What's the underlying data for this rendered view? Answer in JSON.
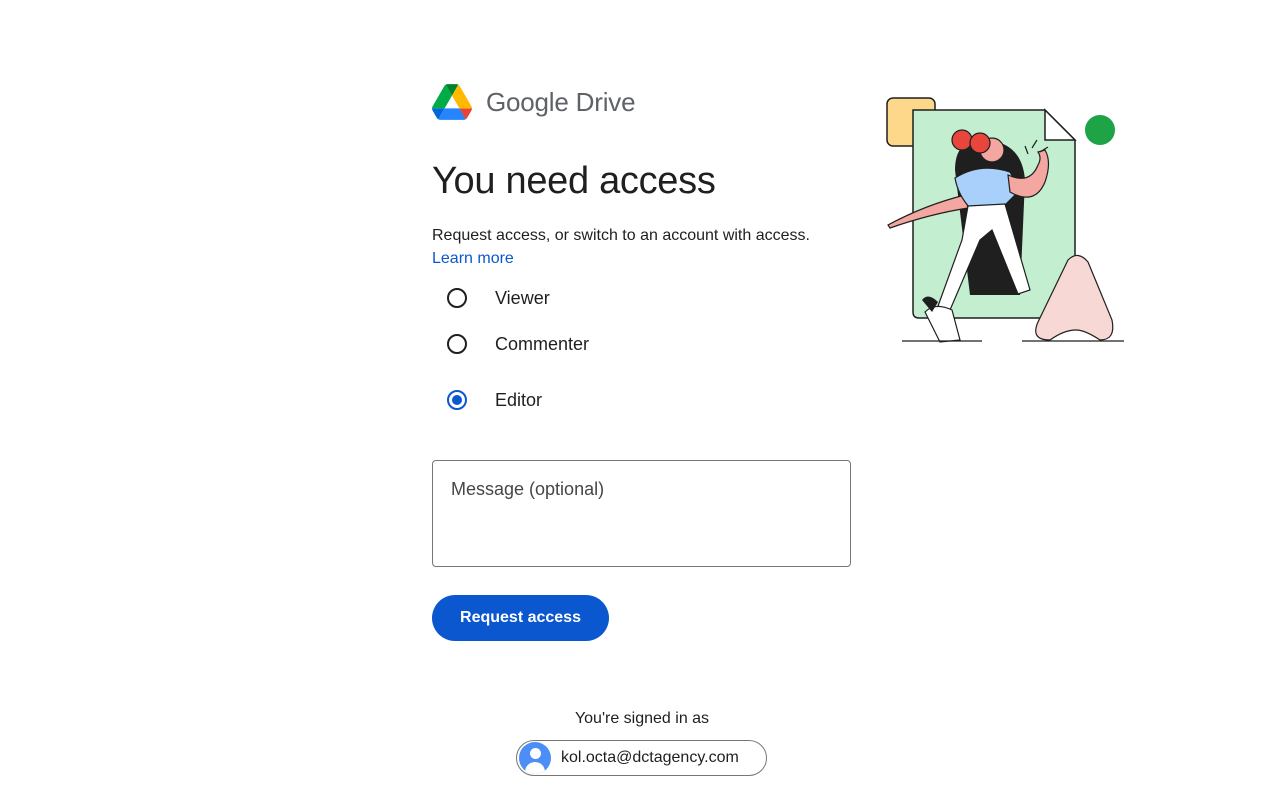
{
  "brand": {
    "name": "Google Drive",
    "logo_colors": {
      "green": "#0f9d58",
      "yellow": "#fbbc04",
      "blue": "#4285f4",
      "red": "#ea4335",
      "dark_green": "#188038"
    }
  },
  "main": {
    "title": "You need access",
    "description": "Request access, or switch to an account with access.",
    "learn_more": "Learn more",
    "roles": [
      {
        "label": "Viewer",
        "selected": false
      },
      {
        "label": "Commenter",
        "selected": false
      },
      {
        "label": "Editor",
        "selected": true
      }
    ],
    "message_placeholder": "Message (optional)",
    "request_button": "Request access"
  },
  "account": {
    "signed_in_label": "You're signed in as",
    "email": "kol.octa@dctagency.com",
    "avatar_icon": "person-icon"
  },
  "colors": {
    "accent": "#0b57d0",
    "text": "#1f1f1f",
    "border": "#747775"
  }
}
